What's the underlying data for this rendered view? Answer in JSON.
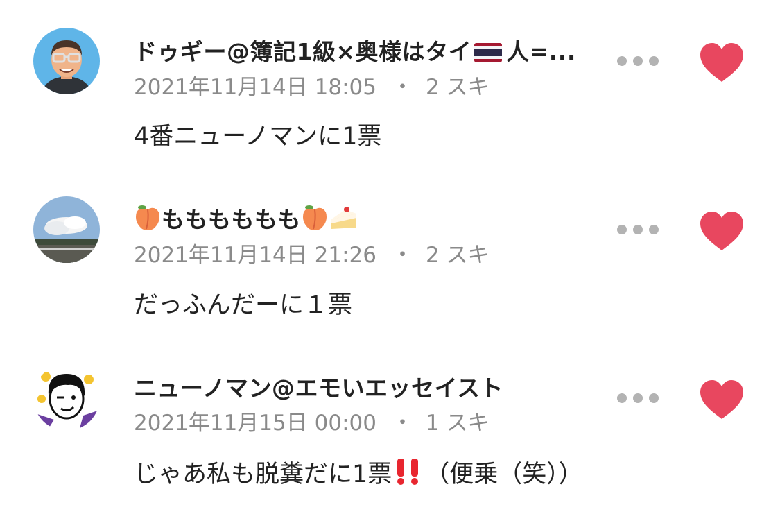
{
  "colors": {
    "heart": "#e8475f",
    "meta_text": "#8a8a8a",
    "dots": "#b3b3b3"
  },
  "comments": [
    {
      "username_part1": "ドゥギー@簿記1級×奥様はタイ",
      "username_part2": "人=...",
      "date": "2021年11月14日 18:05",
      "separator": "・",
      "likes": "2 スキ",
      "text": "4番ニューノマンに1票"
    },
    {
      "username": "もももももも",
      "date": "2021年11月14日 21:26",
      "separator": "・",
      "likes": "2 スキ",
      "text": "だっふんだーに１票"
    },
    {
      "username": "ニューノマン@エモいエッセイスト",
      "date": "2021年11月15日 00:00",
      "separator": "・",
      "likes": "1 スキ",
      "text_part1": "じゃあ私も脱糞だに1票",
      "text_part2": "（便乗（笑））"
    }
  ]
}
